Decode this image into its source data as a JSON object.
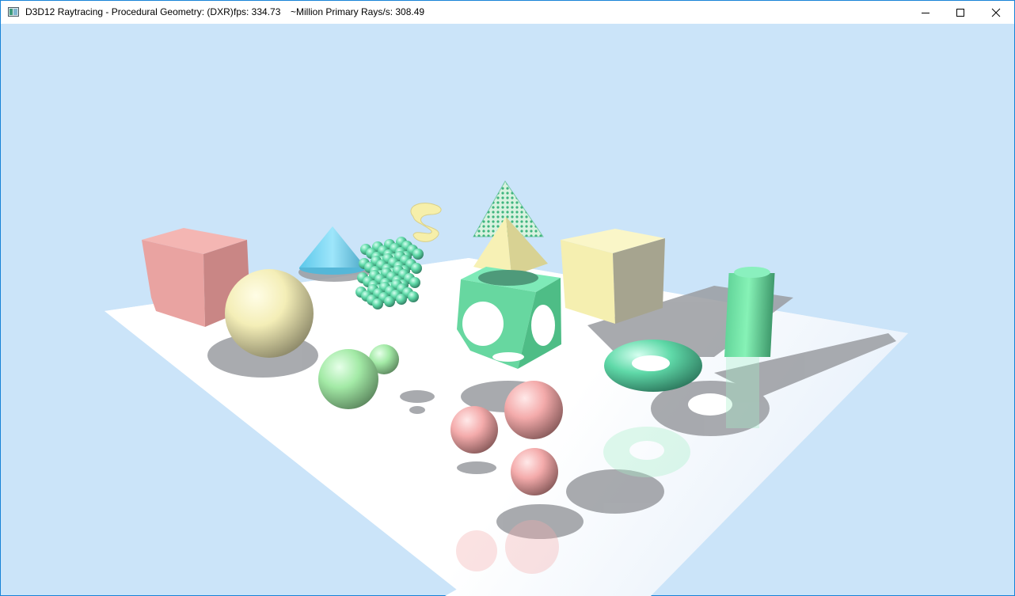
{
  "window": {
    "title": "D3D12 Raytracing - Procedural Geometry: (DXR)",
    "fps_text": "fps: 334.73",
    "rays_text": "~Million Primary Rays/s: 308.49"
  },
  "caption_buttons": {
    "minimize_icon": "minimize-icon",
    "maximize_icon": "maximize-icon",
    "close_icon": "close-icon"
  },
  "scene": {
    "background_color": "#cbe4f9",
    "floor_color": "#ffffff",
    "materials": {
      "red": "#f2a9a9",
      "yellow": "#f7f1b5",
      "green": "#6ee0a0",
      "cyan": "#74d3f0"
    }
  }
}
